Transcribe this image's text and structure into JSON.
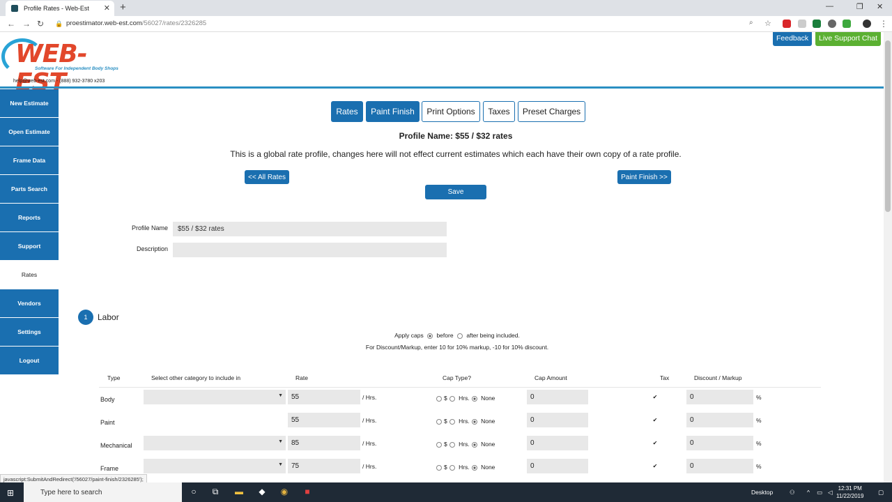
{
  "browser": {
    "tab_title": "Profile Rates - Web-Est",
    "tab_close": "✕",
    "new_tab": "+",
    "url_host": "proestimator.web-est.com",
    "url_path": "/56027/rates/2326285",
    "win_min": "—",
    "win_max": "❐",
    "win_close": "✕"
  },
  "header": {
    "logo_text": "WEB-EST",
    "logo_sub": "Software For Independent Body Shops",
    "contact": "help@web-est.com   -   (888) 932-3780 x203",
    "feedback": "Feedback",
    "live_chat": "Live Support Chat"
  },
  "sidebar": {
    "items": [
      {
        "label": "New Estimate"
      },
      {
        "label": "Open Estimate"
      },
      {
        "label": "Frame Data"
      },
      {
        "label": "Parts Search"
      },
      {
        "label": "Reports"
      },
      {
        "label": "Support"
      },
      {
        "label": "Rates"
      },
      {
        "label": "Vendors"
      },
      {
        "label": "Settings"
      },
      {
        "label": "Logout"
      }
    ]
  },
  "tabs": [
    "Rates",
    "Paint Finish",
    "Print Options",
    "Taxes",
    "Preset Charges"
  ],
  "profile_title": "Profile Name: $55 / $32 rates",
  "notice": "This is a global rate profile, changes here will not effect current estimates which each have their own copy of a rate profile.",
  "buttons": {
    "all_rates": "<< All Rates",
    "paint_finish_next": "Paint Finish >>",
    "save": "Save"
  },
  "form": {
    "profile_name_label": "Profile Name",
    "profile_name_value": "$55 / $32 rates",
    "description_label": "Description",
    "description_value": ""
  },
  "labor": {
    "number": "1",
    "title": "Labor",
    "apply_caps": "Apply caps",
    "before": "before",
    "after": "after being included.",
    "discount_hint": "For Discount/Markup, enter 10 for 10% markup, -10 for 10% discount.",
    "headers": {
      "type": "Type",
      "category": "Select other category to include in",
      "rate": "Rate",
      "cap_type": "Cap Type?",
      "cap_amount": "Cap Amount",
      "tax": "Tax",
      "discount": "Discount / Markup"
    },
    "unit": "/ Hrs.",
    "cap_dollar": "$",
    "cap_hrs": "Hrs.",
    "cap_none": "None",
    "pct": "%",
    "check": "✔",
    "rows": [
      {
        "type": "Body",
        "rate": "55",
        "cap": "0",
        "discount": "0"
      },
      {
        "type": "Paint",
        "rate": "55",
        "cap": "0",
        "discount": "0"
      },
      {
        "type": "Mechanical",
        "rate": "85",
        "cap": "0",
        "discount": "0"
      },
      {
        "type": "Frame",
        "rate": "75",
        "cap": "0",
        "discount": "0"
      }
    ]
  },
  "status_text": "javascript:SubmitAndRedirect('/56027/paint-finish/2326285');",
  "taskbar": {
    "search_placeholder": "Type here to search",
    "desktop": "Desktop",
    "time": "12:31 PM",
    "date": "11/22/2019"
  }
}
